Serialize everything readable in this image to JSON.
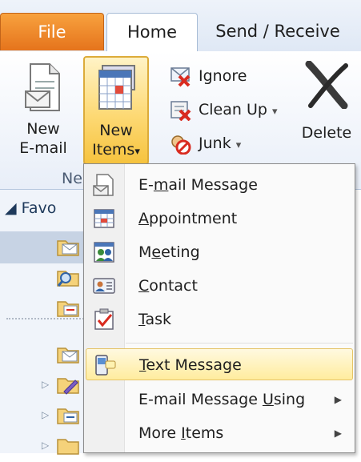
{
  "tabs": {
    "file": "File",
    "home": "Home",
    "send_receive": "Send / Receive"
  },
  "ribbon": {
    "new_email": {
      "line1": "New",
      "line2": "E-mail"
    },
    "new_items": {
      "line1": "New",
      "line2": "Items",
      "arrow": "▾"
    },
    "group_label": "Ne",
    "ignore": "Ignore",
    "clean_up": "Clean Up",
    "junk": "Junk",
    "delete": "Delete",
    "dropdown_arrow": "▾"
  },
  "nav": {
    "favorites": "◢ Favo",
    "expander": "▷"
  },
  "menu": {
    "items": [
      {
        "pre": "E-",
        "key": "m",
        "post": "ail Message",
        "icon": "email-message-icon"
      },
      {
        "pre": "",
        "key": "A",
        "post": "ppointment",
        "icon": "calendar-icon"
      },
      {
        "pre": "M",
        "key": "e",
        "post": "eting",
        "icon": "meeting-icon"
      },
      {
        "pre": "",
        "key": "C",
        "post": "ontact",
        "icon": "contact-card-icon"
      },
      {
        "pre": "",
        "key": "T",
        "post": "ask",
        "icon": "task-icon"
      },
      {
        "pre": "",
        "key": "T",
        "post": "ext Message",
        "icon": "text-message-icon"
      },
      {
        "pre": "E-mail Message ",
        "key": "U",
        "post": "sing",
        "icon": ""
      },
      {
        "pre": "More ",
        "key": "I",
        "post": "tems",
        "icon": ""
      }
    ],
    "submenu_arrow": "▶"
  },
  "colors": {
    "file_tab": "#e5741c",
    "highlight": "#ffec9e",
    "accent_blue": "#1e395b"
  }
}
